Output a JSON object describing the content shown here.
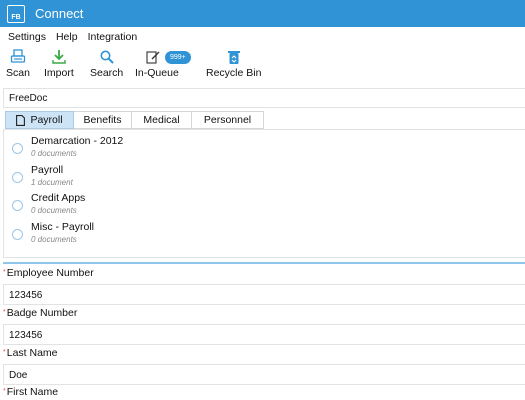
{
  "titlebar": {
    "logo_text": "FB",
    "title": "Connect",
    "color": "#2f93d6"
  },
  "menubar": {
    "items": [
      "Settings",
      "Help",
      "Integration"
    ]
  },
  "toolbar": {
    "scan_label": "Scan",
    "import_label": "Import",
    "search_label": "Search",
    "inqueue_label": "In-Queue",
    "inqueue_badge": "999+",
    "recycle_label": "Recycle Bin"
  },
  "document_field": {
    "value": "FreeDoc"
  },
  "tabs": [
    {
      "label": "Payroll",
      "active": true
    },
    {
      "label": "Benefits",
      "active": false
    },
    {
      "label": "Medical",
      "active": false
    },
    {
      "label": "Personnel",
      "active": false
    }
  ],
  "folders": [
    {
      "name": "Demarcation - 2012",
      "count": "0 documents"
    },
    {
      "name": "Payroll",
      "count": "1 document"
    },
    {
      "name": "Credit Apps",
      "count": "0 documents"
    },
    {
      "name": "Misc - Payroll",
      "count": "0 documents"
    }
  ],
  "fields": [
    {
      "label": "Employee Number",
      "value": "123456",
      "required_marker": "*"
    },
    {
      "label": "Badge Number",
      "value": "123456",
      "required_marker": "*"
    },
    {
      "label": "Last Name",
      "value": "Doe",
      "required_marker": "*"
    },
    {
      "label": "First Name",
      "value": "",
      "required_marker": "*"
    }
  ]
}
